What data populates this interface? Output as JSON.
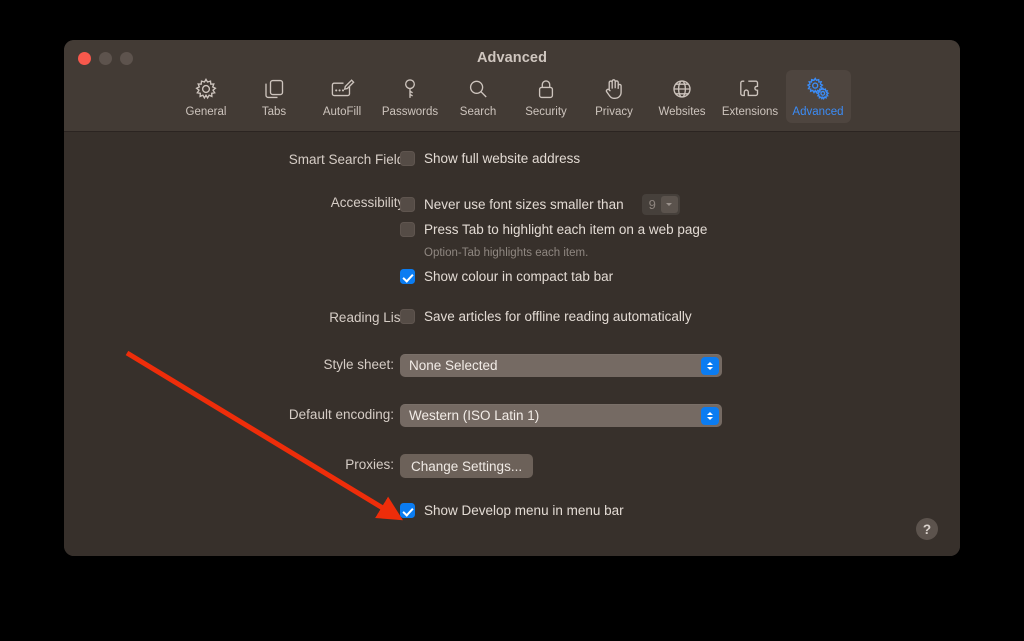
{
  "window": {
    "title": "Advanced",
    "traffic_lights": [
      "close-button",
      "minimize-button",
      "zoom-button"
    ]
  },
  "toolbar": {
    "tabs": [
      {
        "label": "General",
        "icon": "gear-icon",
        "selected": false
      },
      {
        "label": "Tabs",
        "icon": "tabs-icon",
        "selected": false
      },
      {
        "label": "AutoFill",
        "icon": "autofill-icon",
        "selected": false
      },
      {
        "label": "Passwords",
        "icon": "key-icon",
        "selected": false
      },
      {
        "label": "Search",
        "icon": "magnifier-icon",
        "selected": false
      },
      {
        "label": "Security",
        "icon": "lock-icon",
        "selected": false
      },
      {
        "label": "Privacy",
        "icon": "hand-icon",
        "selected": false
      },
      {
        "label": "Websites",
        "icon": "globe-icon",
        "selected": false
      },
      {
        "label": "Extensions",
        "icon": "puzzle-icon",
        "selected": false
      },
      {
        "label": "Advanced",
        "icon": "double-gear-icon",
        "selected": true
      }
    ]
  },
  "settings": {
    "smart_search_field": {
      "label": "Smart Search Field:",
      "checkbox_label": "Show full website address",
      "checked": false
    },
    "accessibility": {
      "label": "Accessibility:",
      "font_size_checkbox_label": "Never use font sizes smaller than",
      "font_size_checked": false,
      "font_size_value": "9",
      "tab_highlight_checkbox_label": "Press Tab to highlight each item on a web page",
      "tab_highlight_checked": false,
      "tab_highlight_hint": "Option-Tab highlights each item.",
      "compact_tab_colour_label": "Show colour in compact tab bar",
      "compact_tab_colour_checked": true
    },
    "reading_list": {
      "label": "Reading List:",
      "checkbox_label": "Save articles for offline reading automatically",
      "checked": false
    },
    "style_sheet": {
      "label": "Style sheet:",
      "value": "None Selected"
    },
    "default_encoding": {
      "label": "Default encoding:",
      "value": "Western (ISO Latin 1)"
    },
    "proxies": {
      "label": "Proxies:",
      "button_label": "Change Settings..."
    },
    "develop_menu": {
      "checkbox_label": "Show Develop menu in menu bar",
      "checked": true
    }
  },
  "help_button": {
    "glyph": "?"
  },
  "annotation": {
    "type": "arrow",
    "color": "#ee2d0a",
    "points_at": "show-develop-menu-checkbox"
  },
  "colors": {
    "accent": "#0a7cf2",
    "selected_tab_text": "#3b8cf6",
    "window_background": "#37302b",
    "titlebar_background": "#433b35",
    "annotation_red": "#ee2d0a"
  }
}
